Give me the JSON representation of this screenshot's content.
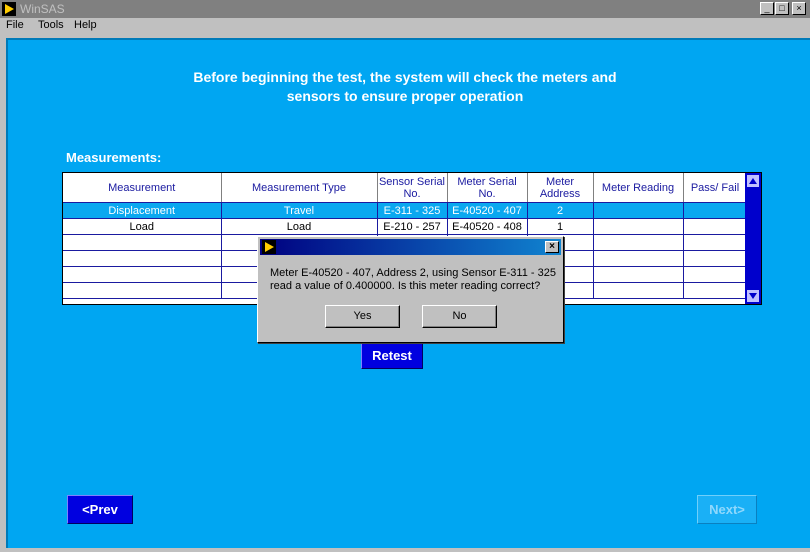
{
  "window": {
    "title": "WinSAS",
    "min": "_",
    "max": "□",
    "close": "×"
  },
  "menu": {
    "file": "File",
    "tools": "Tools",
    "help": "Help"
  },
  "heading": {
    "line1": "Before beginning the test, the system will check the meters and",
    "line2": "sensors to ensure proper operation"
  },
  "section_label": "Measurements:",
  "table": {
    "headers": [
      "Measurement",
      "Measurement Type",
      "Sensor Serial No.",
      "Meter Serial No.",
      "Meter Address",
      "Meter Reading",
      "Pass/ Fail"
    ],
    "rows": [
      [
        "Displacement",
        "Travel",
        "E-311 - 325",
        "E-40520 - 407",
        "2",
        "",
        ""
      ],
      [
        "Load",
        "Load",
        "E-210 - 257",
        "E-40520 - 408",
        "1",
        "",
        ""
      ]
    ]
  },
  "dialog": {
    "close": "×",
    "message": "Meter E-40520 - 407, Address 2, using Sensor E-311 - 325 read a value of 0.400000.  Is this meter reading correct?",
    "yes": "Yes",
    "no": "No"
  },
  "buttons": {
    "retest": "Retest",
    "prev": "<Prev",
    "next": "Next>"
  },
  "colors": {
    "panel": "#00a6f2",
    "button": "#0000e0",
    "selected_row": "#0aa8f0"
  }
}
